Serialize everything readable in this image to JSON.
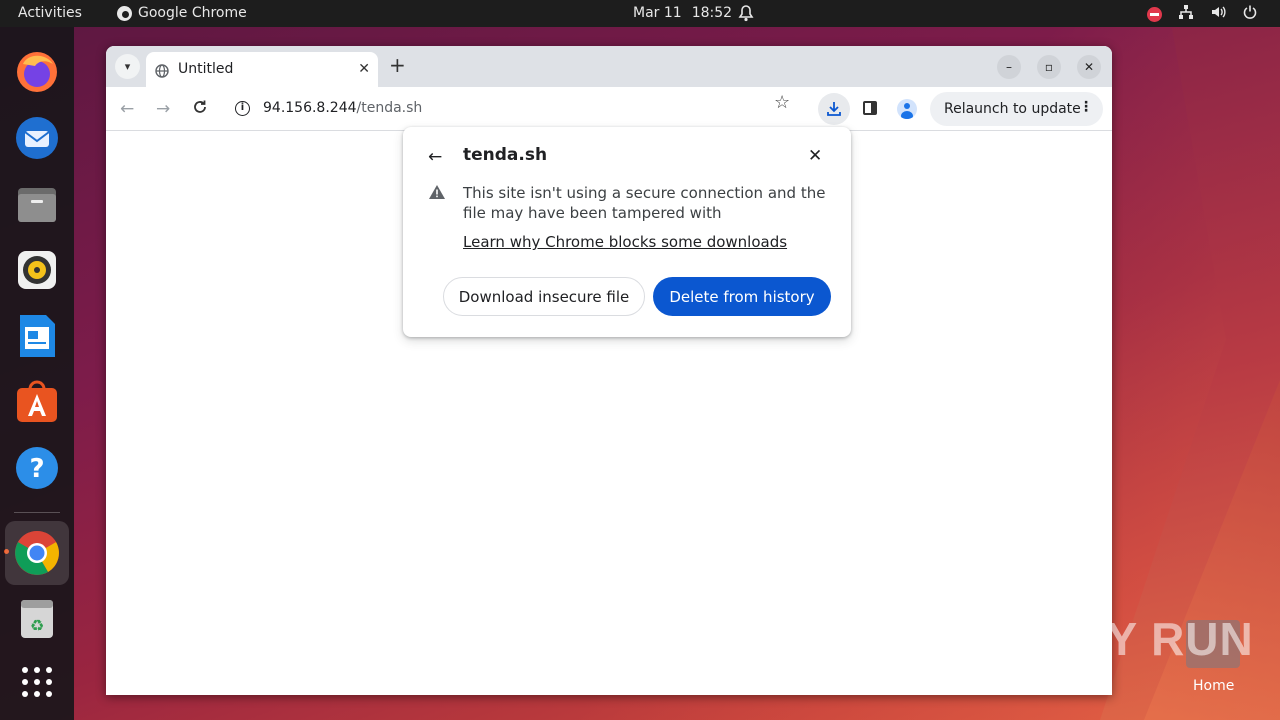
{
  "topbar": {
    "activities": "Activities",
    "app_name": "Google Chrome",
    "date": "Mar 11",
    "time": "18:52"
  },
  "dock": {
    "apps": [
      "firefox-icon",
      "thunderbird-icon",
      "files-icon",
      "rhythmbox-icon",
      "writer-icon",
      "app-center-icon",
      "help-icon",
      "chrome-icon",
      "trash-icon",
      "show-apps-icon"
    ]
  },
  "browser": {
    "tab_title": "Untitled",
    "url_host": "94.156.8.244",
    "url_path": "/tenda.sh",
    "relaunch_label": "Relaunch to update"
  },
  "download_bubble": {
    "filename": "tenda.sh",
    "message": "This site isn't using a secure connection and the file may have been tampered with",
    "learn_link": "Learn why Chrome blocks some downloads",
    "download_button": "Download insecure file",
    "delete_button": "Delete from history"
  },
  "desktop": {
    "home_label": "Home",
    "watermark": "ANY RUN"
  },
  "colors": {
    "accent": "#0b57d0",
    "topbar": "#1d1d1d"
  }
}
